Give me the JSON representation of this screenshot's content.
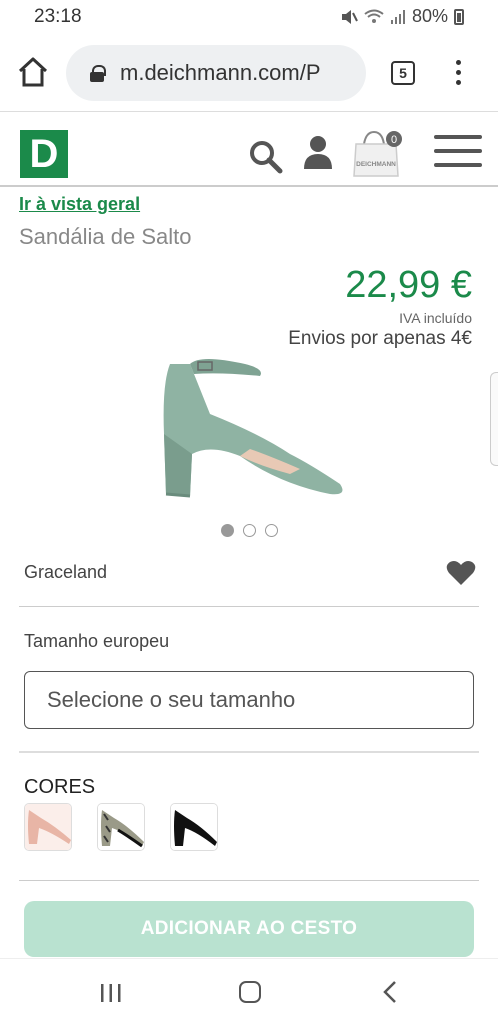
{
  "status_bar": {
    "time": "23:18",
    "battery": "80%"
  },
  "browser": {
    "url": "m.deichmann.com/P",
    "tab_count": "5"
  },
  "header": {
    "logo_letter": "D",
    "bag_count": "0",
    "bag_brand": "DEICHMANN"
  },
  "product": {
    "back_link": "Ir à vista geral",
    "title": "Sandália de Salto",
    "price": "22,99 €",
    "vat_note": "IVA incluído",
    "shipping_note": "Envios por apenas 4€",
    "brand": "Graceland",
    "image_count": 3,
    "active_image": 1
  },
  "size": {
    "label": "Tamanho europeu",
    "placeholder": "Selecione o seu tamanho"
  },
  "colors": {
    "label": "CORES",
    "swatches": [
      "nude-icon",
      "snake-print-icon",
      "black-icon"
    ]
  },
  "cta": {
    "add_to_cart": "ADICIONAR AO CESTO"
  },
  "theme": {
    "brand_green": "#1b8a4a",
    "cta_disabled": "#b9e2d0",
    "shoe_color": "#8fb3a3"
  }
}
